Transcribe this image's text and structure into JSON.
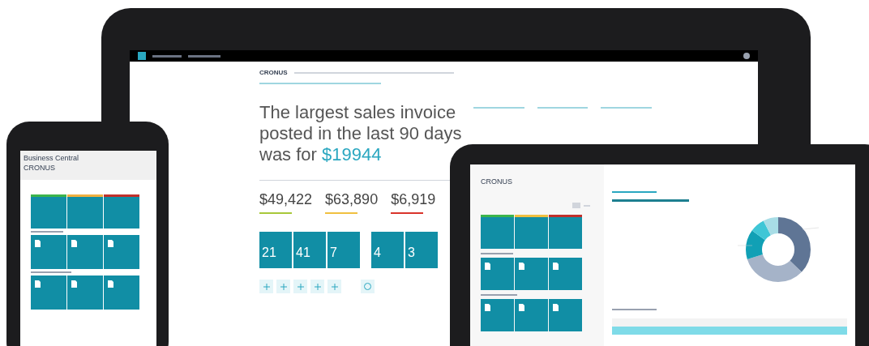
{
  "laptop": {
    "company": "CRONUS",
    "headline": "The largest sales invoice posted in the last 90 days was for",
    "amount": "$19944",
    "kpis": [
      {
        "value": "$49,422",
        "color": "#a8c83a"
      },
      {
        "value": "$63,890",
        "color": "#f0c040"
      },
      {
        "value": "$6,919",
        "color": "#d9342b"
      }
    ],
    "tile_groups": [
      {
        "tiles": [
          "21",
          "41",
          "7"
        ]
      },
      {
        "tiles": [
          "4",
          "3"
        ]
      }
    ],
    "actions": [
      {
        "kind": "plus"
      },
      {
        "kind": "plus"
      },
      {
        "kind": "plus"
      },
      {
        "kind": "plus"
      },
      {
        "kind": "plus"
      },
      {
        "kind": "report"
      }
    ]
  },
  "phone": {
    "title": "Business Central",
    "company": "CRONUS",
    "kpi_tiles": [
      {
        "color": "#3cb44b"
      },
      {
        "color": "#f0b040"
      },
      {
        "color": "#c0302b"
      }
    ]
  },
  "tablet": {
    "company": "CRONUS",
    "kpi_tiles": [
      {
        "color": "#3cb44b"
      },
      {
        "color": "#f0c040"
      },
      {
        "color": "#c0302b"
      }
    ]
  }
}
